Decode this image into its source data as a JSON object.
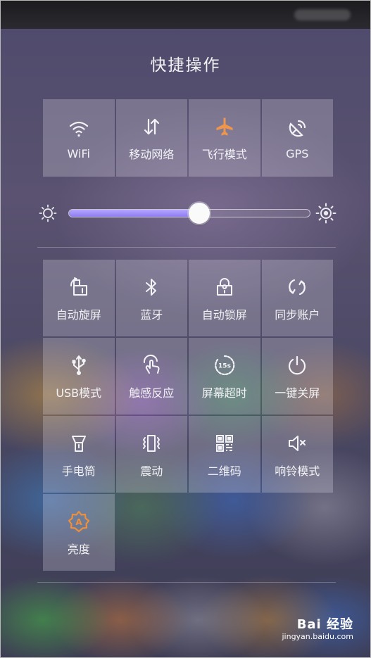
{
  "panel": {
    "title": "快捷操作"
  },
  "top_toggles": [
    {
      "label": "WiFi",
      "icon": "wifi-icon",
      "active": false
    },
    {
      "label": "移动网络",
      "icon": "mobile-data-icon",
      "active": false
    },
    {
      "label": "飞行模式",
      "icon": "airplane-icon",
      "active": true
    },
    {
      "label": "GPS",
      "icon": "gps-icon",
      "active": false
    }
  ],
  "brightness": {
    "level": 0.54
  },
  "toggles": [
    {
      "label": "自动旋屏",
      "icon": "auto-rotate-icon",
      "active": false
    },
    {
      "label": "蓝牙",
      "icon": "bluetooth-icon",
      "active": false
    },
    {
      "label": "自动锁屏",
      "icon": "auto-lock-icon",
      "active": false
    },
    {
      "label": "同步账户",
      "icon": "sync-icon",
      "active": false
    },
    {
      "label": "USB模式",
      "icon": "usb-icon",
      "active": false
    },
    {
      "label": "触感反应",
      "icon": "touch-feedback-icon",
      "active": false
    },
    {
      "label": "屏幕超时",
      "icon": "screen-timeout-icon",
      "active": false,
      "badge": "15s"
    },
    {
      "label": "一键关屏",
      "icon": "power-icon",
      "active": false
    },
    {
      "label": "手电筒",
      "icon": "flashlight-icon",
      "active": false
    },
    {
      "label": "震动",
      "icon": "vibrate-icon",
      "active": false
    },
    {
      "label": "二维码",
      "icon": "qr-code-icon",
      "active": false
    },
    {
      "label": "响铃模式",
      "icon": "mute-icon",
      "active": false
    },
    {
      "label": "亮度",
      "icon": "auto-brightness-icon",
      "active": true,
      "badge": "A"
    }
  ],
  "colors": {
    "accent": "#f0964a",
    "slider": "#9a88f5"
  },
  "watermark": {
    "logo": "Bai 经验",
    "url": "jingyan.baidu.com"
  }
}
